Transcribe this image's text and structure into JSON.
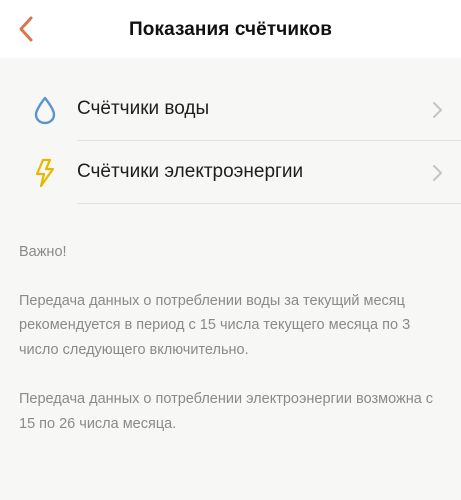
{
  "header": {
    "title": "Показания счётчиков",
    "back_icon": "chevron-left-icon",
    "accent_color": "#d9764f"
  },
  "menu": {
    "items": [
      {
        "label": "Счётчики воды",
        "icon": "water-drop-icon",
        "icon_color": "#5b93d0"
      },
      {
        "label": "Счётчики электроэнергии",
        "icon": "lightning-icon",
        "icon_color": "#e6b800"
      }
    ]
  },
  "notes": {
    "important": "Важно!",
    "water": "Передача данных о потреблении воды за текущий месяц рекомендуется в период с 15 числа текущего месяца по 3 число следующего включительно.",
    "electricity": "Передача данных о потреблении электроэнергии возможна с 15 по 26 числа месяца."
  }
}
